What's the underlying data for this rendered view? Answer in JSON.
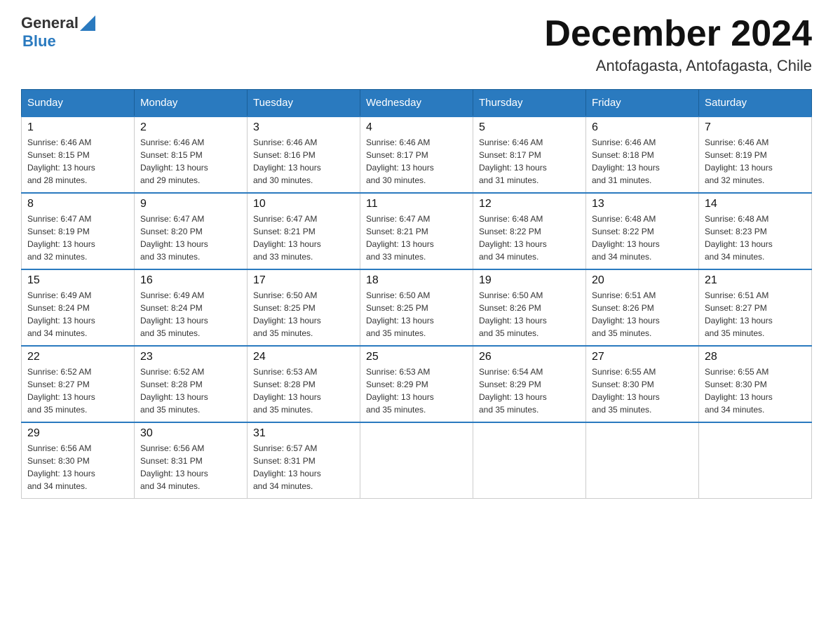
{
  "header": {
    "logo": {
      "text_general": "General",
      "text_blue": "Blue",
      "alt": "GeneralBlue logo"
    },
    "title": "December 2024",
    "location": "Antofagasta, Antofagasta, Chile"
  },
  "calendar": {
    "days_of_week": [
      "Sunday",
      "Monday",
      "Tuesday",
      "Wednesday",
      "Thursday",
      "Friday",
      "Saturday"
    ],
    "weeks": [
      [
        {
          "day": "1",
          "sunrise": "6:46 AM",
          "sunset": "8:15 PM",
          "daylight": "13 hours and 28 minutes."
        },
        {
          "day": "2",
          "sunrise": "6:46 AM",
          "sunset": "8:15 PM",
          "daylight": "13 hours and 29 minutes."
        },
        {
          "day": "3",
          "sunrise": "6:46 AM",
          "sunset": "8:16 PM",
          "daylight": "13 hours and 30 minutes."
        },
        {
          "day": "4",
          "sunrise": "6:46 AM",
          "sunset": "8:17 PM",
          "daylight": "13 hours and 30 minutes."
        },
        {
          "day": "5",
          "sunrise": "6:46 AM",
          "sunset": "8:17 PM",
          "daylight": "13 hours and 31 minutes."
        },
        {
          "day": "6",
          "sunrise": "6:46 AM",
          "sunset": "8:18 PM",
          "daylight": "13 hours and 31 minutes."
        },
        {
          "day": "7",
          "sunrise": "6:46 AM",
          "sunset": "8:19 PM",
          "daylight": "13 hours and 32 minutes."
        }
      ],
      [
        {
          "day": "8",
          "sunrise": "6:47 AM",
          "sunset": "8:19 PM",
          "daylight": "13 hours and 32 minutes."
        },
        {
          "day": "9",
          "sunrise": "6:47 AM",
          "sunset": "8:20 PM",
          "daylight": "13 hours and 33 minutes."
        },
        {
          "day": "10",
          "sunrise": "6:47 AM",
          "sunset": "8:21 PM",
          "daylight": "13 hours and 33 minutes."
        },
        {
          "day": "11",
          "sunrise": "6:47 AM",
          "sunset": "8:21 PM",
          "daylight": "13 hours and 33 minutes."
        },
        {
          "day": "12",
          "sunrise": "6:48 AM",
          "sunset": "8:22 PM",
          "daylight": "13 hours and 34 minutes."
        },
        {
          "day": "13",
          "sunrise": "6:48 AM",
          "sunset": "8:22 PM",
          "daylight": "13 hours and 34 minutes."
        },
        {
          "day": "14",
          "sunrise": "6:48 AM",
          "sunset": "8:23 PM",
          "daylight": "13 hours and 34 minutes."
        }
      ],
      [
        {
          "day": "15",
          "sunrise": "6:49 AM",
          "sunset": "8:24 PM",
          "daylight": "13 hours and 34 minutes."
        },
        {
          "day": "16",
          "sunrise": "6:49 AM",
          "sunset": "8:24 PM",
          "daylight": "13 hours and 35 minutes."
        },
        {
          "day": "17",
          "sunrise": "6:50 AM",
          "sunset": "8:25 PM",
          "daylight": "13 hours and 35 minutes."
        },
        {
          "day": "18",
          "sunrise": "6:50 AM",
          "sunset": "8:25 PM",
          "daylight": "13 hours and 35 minutes."
        },
        {
          "day": "19",
          "sunrise": "6:50 AM",
          "sunset": "8:26 PM",
          "daylight": "13 hours and 35 minutes."
        },
        {
          "day": "20",
          "sunrise": "6:51 AM",
          "sunset": "8:26 PM",
          "daylight": "13 hours and 35 minutes."
        },
        {
          "day": "21",
          "sunrise": "6:51 AM",
          "sunset": "8:27 PM",
          "daylight": "13 hours and 35 minutes."
        }
      ],
      [
        {
          "day": "22",
          "sunrise": "6:52 AM",
          "sunset": "8:27 PM",
          "daylight": "13 hours and 35 minutes."
        },
        {
          "day": "23",
          "sunrise": "6:52 AM",
          "sunset": "8:28 PM",
          "daylight": "13 hours and 35 minutes."
        },
        {
          "day": "24",
          "sunrise": "6:53 AM",
          "sunset": "8:28 PM",
          "daylight": "13 hours and 35 minutes."
        },
        {
          "day": "25",
          "sunrise": "6:53 AM",
          "sunset": "8:29 PM",
          "daylight": "13 hours and 35 minutes."
        },
        {
          "day": "26",
          "sunrise": "6:54 AM",
          "sunset": "8:29 PM",
          "daylight": "13 hours and 35 minutes."
        },
        {
          "day": "27",
          "sunrise": "6:55 AM",
          "sunset": "8:30 PM",
          "daylight": "13 hours and 35 minutes."
        },
        {
          "day": "28",
          "sunrise": "6:55 AM",
          "sunset": "8:30 PM",
          "daylight": "13 hours and 34 minutes."
        }
      ],
      [
        {
          "day": "29",
          "sunrise": "6:56 AM",
          "sunset": "8:30 PM",
          "daylight": "13 hours and 34 minutes."
        },
        {
          "day": "30",
          "sunrise": "6:56 AM",
          "sunset": "8:31 PM",
          "daylight": "13 hours and 34 minutes."
        },
        {
          "day": "31",
          "sunrise": "6:57 AM",
          "sunset": "8:31 PM",
          "daylight": "13 hours and 34 minutes."
        },
        null,
        null,
        null,
        null
      ]
    ]
  },
  "labels": {
    "sunrise_prefix": "Sunrise: ",
    "sunset_prefix": "Sunset: ",
    "daylight_prefix": "Daylight: "
  }
}
